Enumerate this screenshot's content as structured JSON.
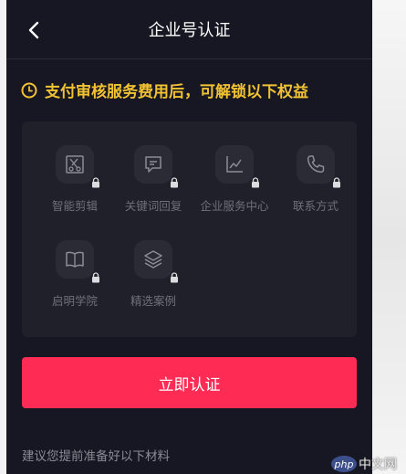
{
  "header": {
    "title": "企业号认证",
    "back_icon": "chevron-left-icon"
  },
  "notice": {
    "text": "支付审核服务费用后，可解锁以下权益",
    "color": "#f1c232",
    "icon": "clock-icon"
  },
  "benefits": [
    {
      "label": "智能剪辑",
      "icon": "scissors-icon",
      "locked": true
    },
    {
      "label": "关键词回复",
      "icon": "chat-icon",
      "locked": true
    },
    {
      "label": "企业服务中心",
      "icon": "chart-icon",
      "locked": true
    },
    {
      "label": "联系方式",
      "icon": "phone-icon",
      "locked": true
    },
    {
      "label": "启明学院",
      "icon": "book-icon",
      "locked": true
    },
    {
      "label": "精选案例",
      "icon": "layers-icon",
      "locked": true
    }
  ],
  "cta": {
    "label": "立即认证",
    "color": "#fe2c55"
  },
  "materials_hint": "建议您提前准备好以下材料",
  "watermark": {
    "logo": "php",
    "text": "中文网"
  }
}
